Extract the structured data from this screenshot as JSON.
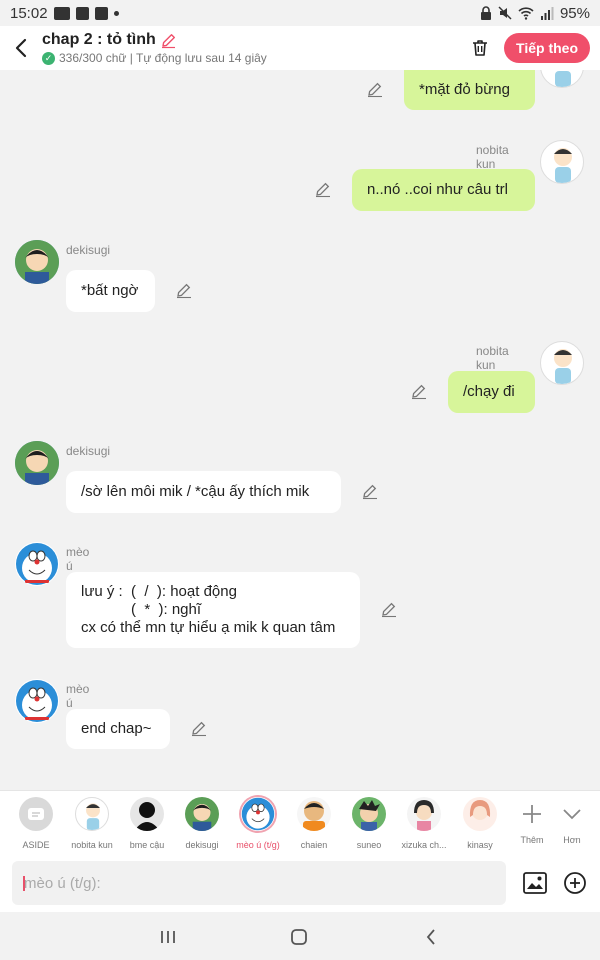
{
  "status_bar": {
    "time": "15:02",
    "battery": "95%"
  },
  "header": {
    "title": "chap 2 : tỏ tình",
    "subtitle": "336/300 chữ | Tự động lưu sau 14 giây",
    "next_button": "Tiếp theo"
  },
  "messages": [
    {
      "side": "me",
      "name": "",
      "lines": [
        "*mặt đỏ bừng"
      ]
    },
    {
      "side": "me",
      "name": "nobita kun",
      "lines": [
        "n..nó ..coi như câu trl"
      ]
    },
    {
      "side": "them",
      "name": "dekisugi",
      "lines": [
        "*bất ngờ"
      ]
    },
    {
      "side": "me",
      "name": "nobita kun",
      "lines": [
        "/chạy đi"
      ]
    },
    {
      "side": "them",
      "name": "dekisugi",
      "lines": [
        "/sờ lên môi mik / *cậu ấy thích mik"
      ]
    },
    {
      "side": "them",
      "name": "mèo ú (t/g)",
      "lines": [
        "lưu ý :  (  /  ): hoạt động",
        "            (  *  ): nghĩ",
        "cx có thể mn tự hiểu ạ mik k quan tâm"
      ]
    },
    {
      "side": "them",
      "name": "mèo ú (t/g)",
      "lines": [
        "end chap~"
      ]
    }
  ],
  "characters": [
    {
      "label": "ASIDE",
      "icon": "aside-icon"
    },
    {
      "label": "nobita kun",
      "icon": "nobita-avatar"
    },
    {
      "label": "bme cậu",
      "icon": "silhouette-avatar"
    },
    {
      "label": "dekisugi",
      "icon": "dekisugi-avatar"
    },
    {
      "label": "mèo ú (t/g)",
      "icon": "doraemon-avatar",
      "active": true
    },
    {
      "label": "chaien",
      "icon": "chaien-avatar"
    },
    {
      "label": "suneo",
      "icon": "suneo-avatar"
    },
    {
      "label": "xizuka ch...",
      "icon": "xizuka-avatar"
    },
    {
      "label": "kinasy",
      "icon": "kinasy-avatar"
    },
    {
      "label": "Thêm",
      "icon": "plus-icon"
    },
    {
      "label": "Hơn",
      "icon": "chevron-down-icon"
    }
  ],
  "input": {
    "placeholder": "mèo ú (t/g):"
  },
  "colors": {
    "accent": "#f04f6a",
    "my_bubble": "#d7f59a",
    "their_bubble": "#ffffff",
    "background": "#f2f2f2"
  }
}
